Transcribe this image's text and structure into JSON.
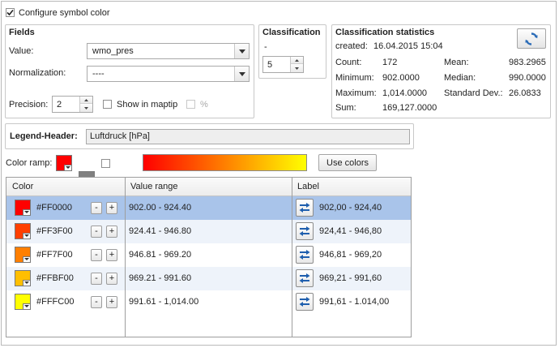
{
  "configure": {
    "label": "Configure symbol color",
    "checked": true
  },
  "fields": {
    "title": "Fields",
    "value_label": "Value:",
    "value": "wmo_pres",
    "normalization_label": "Normalization:",
    "normalization": "----",
    "precision_label": "Precision:",
    "precision": "2",
    "show_label": "Show in maptip",
    "percent_label": "%"
  },
  "classification": {
    "title": "Classification",
    "dash": "-",
    "count": "5"
  },
  "statistics": {
    "title": "Classification statistics",
    "created_label": "created:",
    "created": "16.04.2015 15:04",
    "left": [
      {
        "label": "Count:",
        "value": "172"
      },
      {
        "label": "Minimum:",
        "value": "902.0000"
      },
      {
        "label": "Maximum:",
        "value": "1,014.0000"
      },
      {
        "label": "Sum:",
        "value": "169,127.0000"
      }
    ],
    "right": [
      {
        "label": "Mean:",
        "value": "983.2965"
      },
      {
        "label": "Median:",
        "value": "990.0000"
      },
      {
        "label": "Standard Dev.:",
        "value": "26.0833"
      }
    ]
  },
  "legend": {
    "label": "Legend-Header:",
    "value": "Luftdruck [hPa]"
  },
  "ramp": {
    "label": "Color ramp:",
    "start_color": "#FF0000",
    "mid_color": "#808080",
    "end_color": "#FFFF00",
    "use_colors_label": "Use colors"
  },
  "table": {
    "columns": [
      "Color",
      "Value range",
      "Label"
    ],
    "rows": [
      {
        "color": "#FF0000",
        "hex": "#FF0000",
        "range": "902.00 - 924.40",
        "label": "902,00 - 924,40",
        "selected": true
      },
      {
        "color": "#FF3F00",
        "hex": "#FF3F00",
        "range": "924.41 - 946.80",
        "label": "924,41 - 946,80",
        "selected": false
      },
      {
        "color": "#FF7F00",
        "hex": "#FF7F00",
        "range": "946.81 - 969.20",
        "label": "946,81 - 969,20",
        "selected": false
      },
      {
        "color": "#FFBF00",
        "hex": "#FFBF00",
        "range": "969.21 - 991.60",
        "label": "969,21 - 991,60",
        "selected": false
      },
      {
        "color": "#FFFF00",
        "hex": "#FFFC00",
        "range": "991.61 - 1,014.00",
        "label": "991,61 - 1.014,00",
        "selected": false
      }
    ],
    "minus": "-",
    "plus": "+",
    "selected_bg": "#a9c4ea",
    "alt_bg": "#eef3fa"
  }
}
